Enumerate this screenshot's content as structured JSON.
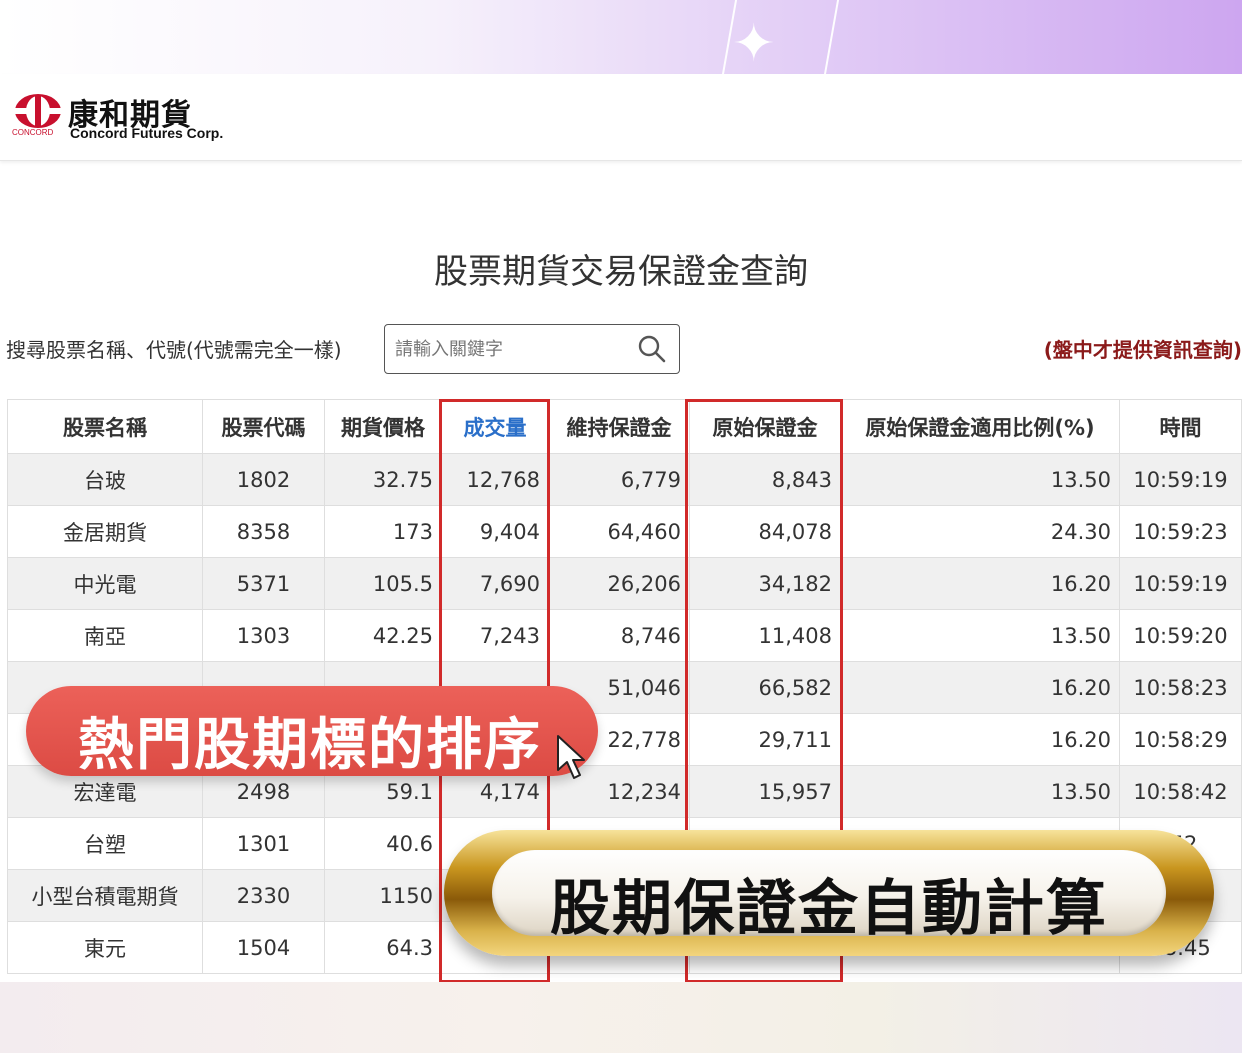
{
  "brand": {
    "name_cn": "康和期貨",
    "name_en": "Concord Futures Corp.",
    "small_mark": "CONCORD",
    "accent": "#c8102e"
  },
  "page": {
    "title": "股票期貨交易保證金查詢"
  },
  "search": {
    "label": "搜尋股票名稱、代號(代號需完全一樣)",
    "placeholder": "請輸入關鍵字",
    "icon": "search-icon"
  },
  "notice": "(盤中才提供資訊查詢)",
  "table": {
    "headers": [
      "股票名稱",
      "股票代碼",
      "期貨價格",
      "成交量",
      "維持保證金",
      "原始保證金",
      "原始保證金適用比例(%)",
      "時間"
    ],
    "sorted_column": "成交量",
    "rows": [
      {
        "name": "台玻",
        "code": "1802",
        "price": "32.75",
        "volume": "12,768",
        "maint": "6,779",
        "initial": "8,843",
        "ratio": "13.50",
        "time": "10:59:19"
      },
      {
        "name": "金居期貨",
        "code": "8358",
        "price": "173",
        "volume": "9,404",
        "maint": "64,460",
        "initial": "84,078",
        "ratio": "24.30",
        "time": "10:59:23"
      },
      {
        "name": "中光電",
        "code": "5371",
        "price": "105.5",
        "volume": "7,690",
        "maint": "26,206",
        "initial": "34,182",
        "ratio": "16.20",
        "time": "10:59:19"
      },
      {
        "name": "南亞",
        "code": "1303",
        "price": "42.25",
        "volume": "7,243",
        "maint": "8,746",
        "initial": "11,408",
        "ratio": "13.50",
        "time": "10:59:20"
      },
      {
        "name": "",
        "code": "",
        "price": "",
        "volume": "",
        "maint": "51,046",
        "initial": "66,582",
        "ratio": "16.20",
        "time": "10:58:23"
      },
      {
        "name": "",
        "code": "",
        "price": "",
        "volume": "",
        "maint": "22,778",
        "initial": "29,711",
        "ratio": "16.20",
        "time": "10:58:29"
      },
      {
        "name": "宏達電",
        "code": "2498",
        "price": "59.1",
        "volume": "4,174",
        "maint": "12,234",
        "initial": "15,957",
        "ratio": "13.50",
        "time": "10:58:42"
      },
      {
        "name": "台塑",
        "code": "1301",
        "price": "40.6",
        "volume": "",
        "maint": "",
        "initial": "",
        "ratio": "",
        "time": ":52"
      },
      {
        "name": "小型台積電期貨",
        "code": "2330",
        "price": "1150",
        "volume": "",
        "maint": "",
        "initial": "",
        "ratio": "",
        "time": "7"
      },
      {
        "name": "東元",
        "code": "1504",
        "price": "64.3",
        "volume": "",
        "maint": "",
        "initial": "",
        "ratio": "",
        "time": "58:45"
      }
    ]
  },
  "overlay": {
    "sort_caption": "熱門股期標的排序",
    "margin_caption": "股期保證金自動計算",
    "red_color": "#e0514a",
    "gold_color": "#c9961f",
    "highlight_color": "#d12a2a"
  }
}
